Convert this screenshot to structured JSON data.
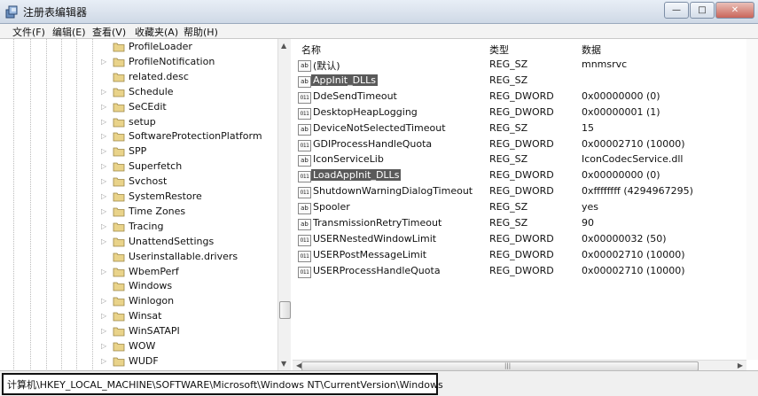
{
  "window": {
    "title": "注册表编辑器"
  },
  "menu": [
    "文件(F)",
    "编辑(E)",
    "查看(V)",
    "收藏夹(A)",
    "帮助(H)"
  ],
  "tree": {
    "items": [
      {
        "label": "ProfileLoader",
        "arrow": false
      },
      {
        "label": "ProfileNotification",
        "arrow": true
      },
      {
        "label": "related.desc",
        "arrow": false
      },
      {
        "label": "Schedule",
        "arrow": true
      },
      {
        "label": "SeCEdit",
        "arrow": true
      },
      {
        "label": "setup",
        "arrow": true
      },
      {
        "label": "SoftwareProtectionPlatform",
        "arrow": true
      },
      {
        "label": "SPP",
        "arrow": true
      },
      {
        "label": "Superfetch",
        "arrow": true
      },
      {
        "label": "Svchost",
        "arrow": true
      },
      {
        "label": "SystemRestore",
        "arrow": true
      },
      {
        "label": "Time Zones",
        "arrow": true
      },
      {
        "label": "Tracing",
        "arrow": true
      },
      {
        "label": "UnattendSettings",
        "arrow": true
      },
      {
        "label": "Userinstallable.drivers",
        "arrow": false
      },
      {
        "label": "WbemPerf",
        "arrow": true
      },
      {
        "label": "Windows",
        "arrow": false
      },
      {
        "label": "Winlogon",
        "arrow": true
      },
      {
        "label": "Winsat",
        "arrow": true
      },
      {
        "label": "WinSATAPI",
        "arrow": true
      },
      {
        "label": "WOW",
        "arrow": true
      },
      {
        "label": "WUDF",
        "arrow": true
      }
    ]
  },
  "values": {
    "headers": {
      "name": "名称",
      "type": "类型",
      "data": "数据"
    },
    "rows": [
      {
        "icon": "ab",
        "name": "(默认)",
        "type": "REG_SZ",
        "data": "mnmsrvc",
        "selected": false
      },
      {
        "icon": "ab",
        "name": "AppInit_DLLs",
        "type": "REG_SZ",
        "data": "",
        "selected": true
      },
      {
        "icon": "bin",
        "name": "DdeSendTimeout",
        "type": "REG_DWORD",
        "data": "0x00000000 (0)",
        "selected": false
      },
      {
        "icon": "bin",
        "name": "DesktopHeapLogging",
        "type": "REG_DWORD",
        "data": "0x00000001 (1)",
        "selected": false
      },
      {
        "icon": "ab",
        "name": "DeviceNotSelectedTimeout",
        "type": "REG_SZ",
        "data": "15",
        "selected": false
      },
      {
        "icon": "bin",
        "name": "GDIProcessHandleQuota",
        "type": "REG_DWORD",
        "data": "0x00002710 (10000)",
        "selected": false
      },
      {
        "icon": "ab",
        "name": "IconServiceLib",
        "type": "REG_SZ",
        "data": "IconCodecService.dll",
        "selected": false
      },
      {
        "icon": "bin",
        "name": "LoadAppInit_DLLs",
        "type": "REG_DWORD",
        "data": "0x00000000 (0)",
        "selected": true
      },
      {
        "icon": "bin",
        "name": "ShutdownWarningDialogTimeout",
        "type": "REG_DWORD",
        "data": "0xffffffff (4294967295)",
        "selected": false
      },
      {
        "icon": "ab",
        "name": "Spooler",
        "type": "REG_SZ",
        "data": "yes",
        "selected": false
      },
      {
        "icon": "ab",
        "name": "TransmissionRetryTimeout",
        "type": "REG_SZ",
        "data": "90",
        "selected": false
      },
      {
        "icon": "bin",
        "name": "USERNestedWindowLimit",
        "type": "REG_DWORD",
        "data": "0x00000032 (50)",
        "selected": false
      },
      {
        "icon": "bin",
        "name": "USERPostMessageLimit",
        "type": "REG_DWORD",
        "data": "0x00002710 (10000)",
        "selected": false
      },
      {
        "icon": "bin",
        "name": "USERProcessHandleQuota",
        "type": "REG_DWORD",
        "data": "0x00002710 (10000)",
        "selected": false
      }
    ]
  },
  "status": {
    "path": "计算机\\HKEY_LOCAL_MACHINE\\SOFTWARE\\Microsoft\\Windows NT\\CurrentVersion\\Windows"
  },
  "icons": {
    "ab": "string-value-icon",
    "bin": "binary-value-icon"
  }
}
